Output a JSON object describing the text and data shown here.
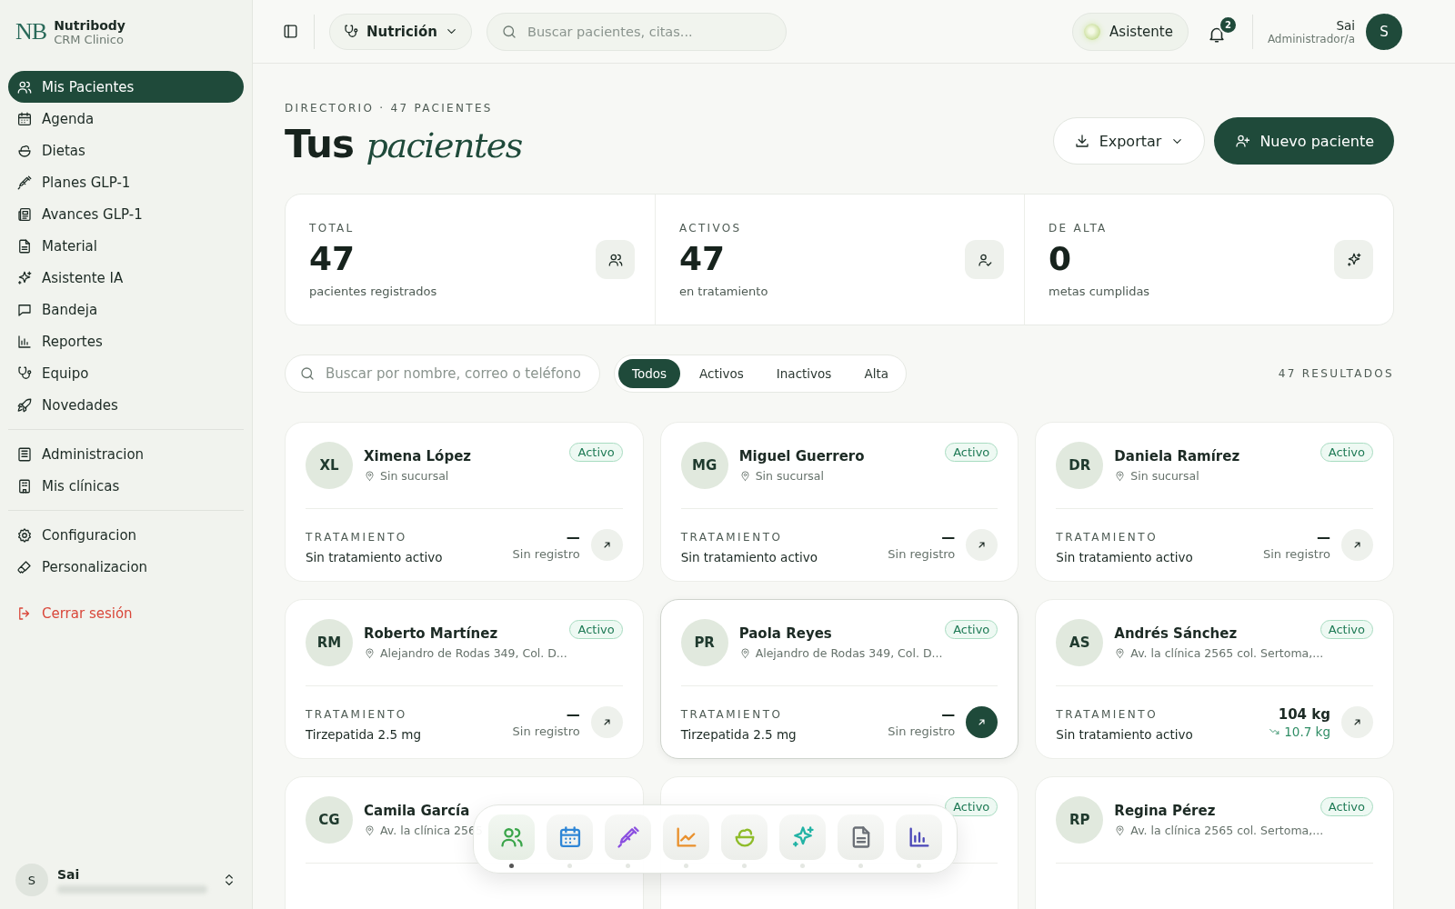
{
  "brand": {
    "logo": "NB",
    "name": "Nutribody",
    "subtitle": "CRM Clinico"
  },
  "sidebar": {
    "groups": [
      [
        {
          "label": "Mis Pacientes",
          "selected": true
        },
        {
          "label": "Agenda",
          "selected": false
        },
        {
          "label": "Dietas",
          "selected": false
        },
        {
          "label": "Planes GLP-1",
          "selected": false
        },
        {
          "label": "Avances GLP-1",
          "selected": false
        },
        {
          "label": "Material",
          "selected": false
        },
        {
          "label": "Asistente IA",
          "selected": false
        },
        {
          "label": "Bandeja",
          "selected": false
        },
        {
          "label": "Reportes",
          "selected": false
        },
        {
          "label": "Equipo",
          "selected": false
        },
        {
          "label": "Novedades",
          "selected": false
        }
      ],
      [
        {
          "label": "Administracion",
          "selected": false
        },
        {
          "label": "Mis clínicas",
          "selected": false
        }
      ],
      [
        {
          "label": "Configuracion",
          "selected": false
        },
        {
          "label": "Personalizacion",
          "selected": false
        }
      ]
    ],
    "logout": "Cerrar sesión",
    "user": {
      "initial": "S",
      "name": "Sai"
    }
  },
  "topbar": {
    "specialty": "Nutrición",
    "search": {
      "placeholder": "Buscar pacientes, citas..."
    },
    "assistant": "Asistente",
    "notifications": "2",
    "user": {
      "name": "Sai",
      "role": "Administrador/a",
      "initial": "S"
    }
  },
  "page": {
    "eyebrow": "DIRECTORIO · 47 PACIENTES",
    "title": "Tus *pacientes*",
    "buttons": [
      "Exportar",
      "Nuevo paciente"
    ]
  },
  "stats": [
    {
      "label": "TOTAL",
      "value": "47",
      "caption": "pacientes registrados"
    },
    {
      "label": "ACTIVOS",
      "value": "47",
      "caption": "en tratamiento"
    },
    {
      "label": "DE ALTA",
      "value": "0",
      "caption": "metas cumplidas"
    }
  ],
  "filters": {
    "search": {
      "placeholder": "Buscar por nombre, correo o teléfono"
    },
    "tabs": [
      {
        "label": "Todos",
        "selected": true
      },
      {
        "label": "Activos",
        "selected": false
      },
      {
        "label": "Inactivos",
        "selected": false
      },
      {
        "label": "Alta",
        "selected": false
      }
    ],
    "results": "47 RESULTADOS"
  },
  "patients": [
    {
      "initials": "XL",
      "name": "Ximena López",
      "location": "Sin sucursal",
      "status": "Activo",
      "treatment_label": "TRATAMIENTO",
      "treatment": "Sin tratamiento activo",
      "weight": "—",
      "note": "Sin registro",
      "selected": false
    },
    {
      "initials": "MG",
      "name": "Miguel Guerrero",
      "location": "Sin sucursal",
      "status": "Activo",
      "treatment_label": "TRATAMIENTO",
      "treatment": "Sin tratamiento activo",
      "weight": "—",
      "note": "Sin registro",
      "selected": false
    },
    {
      "initials": "DR",
      "name": "Daniela Ramírez",
      "location": "Sin sucursal",
      "status": "Activo",
      "treatment_label": "TRATAMIENTO",
      "treatment": "Sin tratamiento activo",
      "weight": "—",
      "note": "Sin registro",
      "selected": false
    },
    {
      "initials": "RM",
      "name": "Roberto Martínez",
      "location": "Alejandro de Rodas 349, Col. D...",
      "status": "Activo",
      "treatment_label": "TRATAMIENTO",
      "treatment": "Tirzepatida 2.5 mg",
      "weight": "—",
      "note": "Sin registro",
      "selected": false
    },
    {
      "initials": "PR",
      "name": "Paola Reyes",
      "location": "Alejandro de Rodas 349, Col. D...",
      "status": "Activo",
      "treatment_label": "TRATAMIENTO",
      "treatment": "Tirzepatida 2.5 mg",
      "weight": "—",
      "note": "Sin registro",
      "selected": true
    },
    {
      "initials": "AS",
      "name": "Andrés Sánchez",
      "location": "Av. la clínica 2565 col. Sertoma,...",
      "status": "Activo",
      "treatment_label": "TRATAMIENTO",
      "treatment": "Sin tratamiento activo",
      "weight": "104 kg",
      "change": "10.7 kg",
      "selected": false
    },
    {
      "initials": "CG",
      "name": "Camila García",
      "location": "Av. la clínica 2565",
      "selected": false
    },
    {
      "status": "Activo",
      "selected": false
    },
    {
      "initials": "RP",
      "name": "Regina Pérez",
      "location": "Av. la clínica 2565 col. Sertoma,...",
      "status": "Activo",
      "selected": false
    }
  ],
  "dock": [
    {
      "selected": true
    },
    {
      "selected": false
    },
    {
      "selected": false
    },
    {
      "selected": false
    },
    {
      "selected": false
    },
    {
      "selected": false
    },
    {
      "selected": false
    },
    {
      "selected": false
    }
  ]
}
